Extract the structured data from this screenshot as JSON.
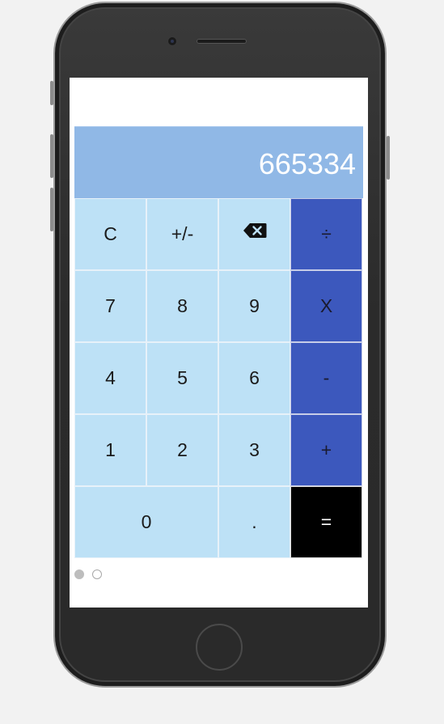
{
  "display": {
    "value": "665334"
  },
  "keys": {
    "clear": "C",
    "negate": "+/-",
    "divide": "÷",
    "seven": "7",
    "eight": "8",
    "nine": "9",
    "multiply": "X",
    "four": "4",
    "five": "5",
    "six": "6",
    "subtract": "-",
    "one": "1",
    "two": "2",
    "three": "3",
    "add": "+",
    "zero": "0",
    "decimal": ".",
    "equals": "="
  },
  "icons": {
    "backspace": "backspace-icon"
  },
  "pager": {
    "pages": 2,
    "active_index": 0
  },
  "colors": {
    "display_bg": "#90b8e6",
    "key_bg": "#bde1f6",
    "operator_bg": "#3c58bd",
    "equals_bg": "#000000"
  }
}
